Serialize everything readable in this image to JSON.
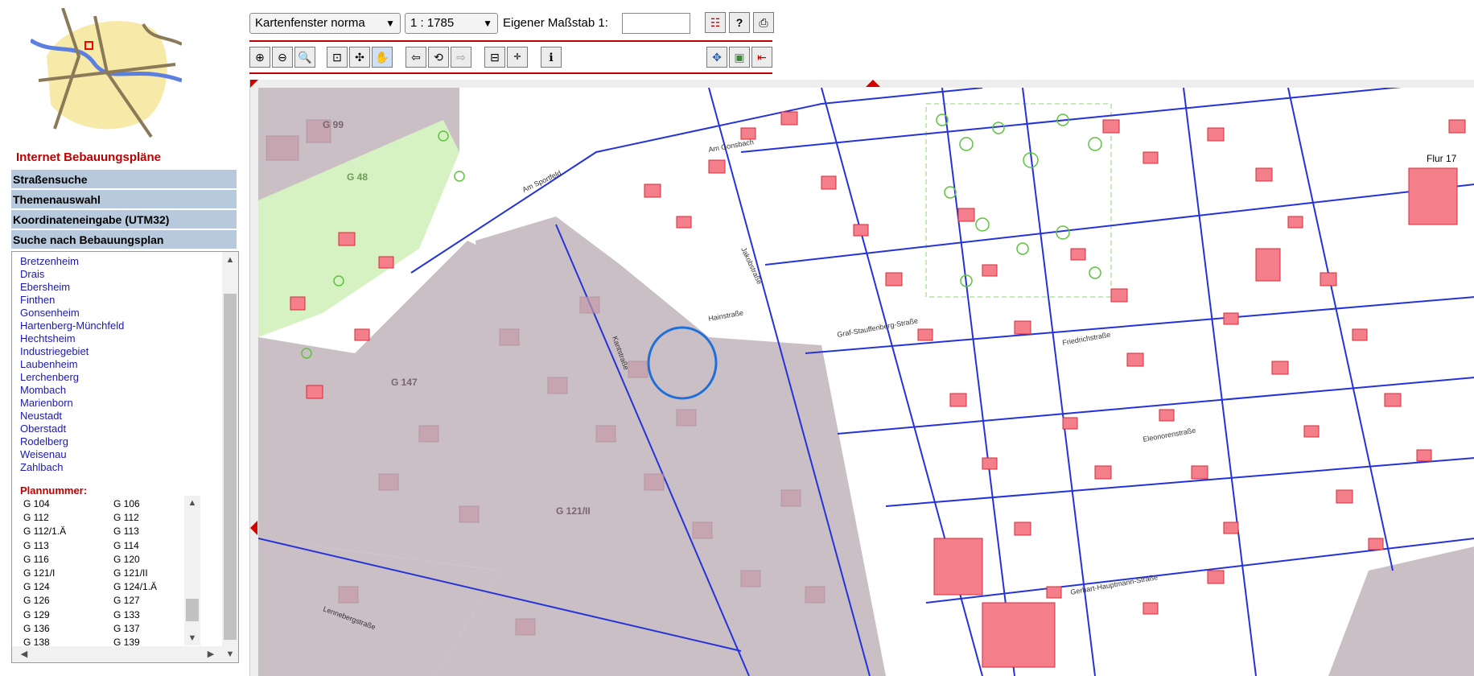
{
  "left_panel": {
    "title": "Internet Bebauungspläne",
    "accordion": [
      "Straßensuche",
      "Themenauswahl",
      "Koordinateneingabe (UTM32)",
      "Suche nach Bebauungsplan"
    ],
    "districts": [
      "Bretzenheim",
      "Drais",
      "Ebersheim",
      "Finthen",
      "Gonsenheim",
      "Hartenberg-Münchfeld",
      "Hechtsheim",
      "Industriegebiet",
      "Laubenheim",
      "Lerchenberg",
      "Mombach",
      "Marienborn",
      "Neustadt",
      "Oberstadt",
      "Rodelberg",
      "Weisenau",
      "Zahlbach"
    ],
    "plan_label": "Plannummer:",
    "plans": [
      [
        "G 104",
        "G 106"
      ],
      [
        "G 112",
        "G 112"
      ],
      [
        "G 112/1.Ä",
        "G 113"
      ],
      [
        "G 113",
        "G 114"
      ],
      [
        "G 116",
        "G 120"
      ],
      [
        "G 121/I",
        "G 121/II"
      ],
      [
        "G 124",
        "G 124/1.Ä"
      ],
      [
        "G 126",
        "G 127"
      ],
      [
        "G 129",
        "G 133"
      ],
      [
        "G 136",
        "G 137"
      ],
      [
        "G 138",
        "G 139"
      ]
    ]
  },
  "toolbar": {
    "window_select": "Kartenfenster norma",
    "scale_select": "1 : 1785",
    "scale_label": "Eigener Maßstab 1:",
    "scale_value": "",
    "icons": [
      "legend-icon",
      "help-icon",
      "print-icon",
      "zoom-in-icon",
      "zoom-out-icon",
      "zoom-box-icon",
      "zoom-full-icon",
      "zoom-select-icon",
      "pan-hand-icon",
      "back-icon",
      "refresh-icon",
      "forward-icon",
      "measure-icon",
      "coordinate-icon",
      "info-icon",
      "move-icon",
      "image-icon",
      "exit-icon"
    ]
  },
  "map": {
    "plan_labels": [
      "G 99",
      "G 48",
      "G 147",
      "G 121/II",
      "Flur 17"
    ],
    "streets": [
      "Am Sportfeld",
      "Jakobstraße",
      "Am Gonsbach",
      "Hainstraße",
      "Graf-Stauffenberg-Straße",
      "Friedrichstraße",
      "Eleonorenstraße",
      "Gerhart-Hauptmann-Straße",
      "Kantstraße",
      "Lennebergstraße"
    ]
  },
  "colors": {
    "accent": "#c00000",
    "accordion": "#b7c9dc",
    "link": "#1a1aa6",
    "plan_area": "#cbbfc6",
    "green_area": "#d6f2c2"
  }
}
